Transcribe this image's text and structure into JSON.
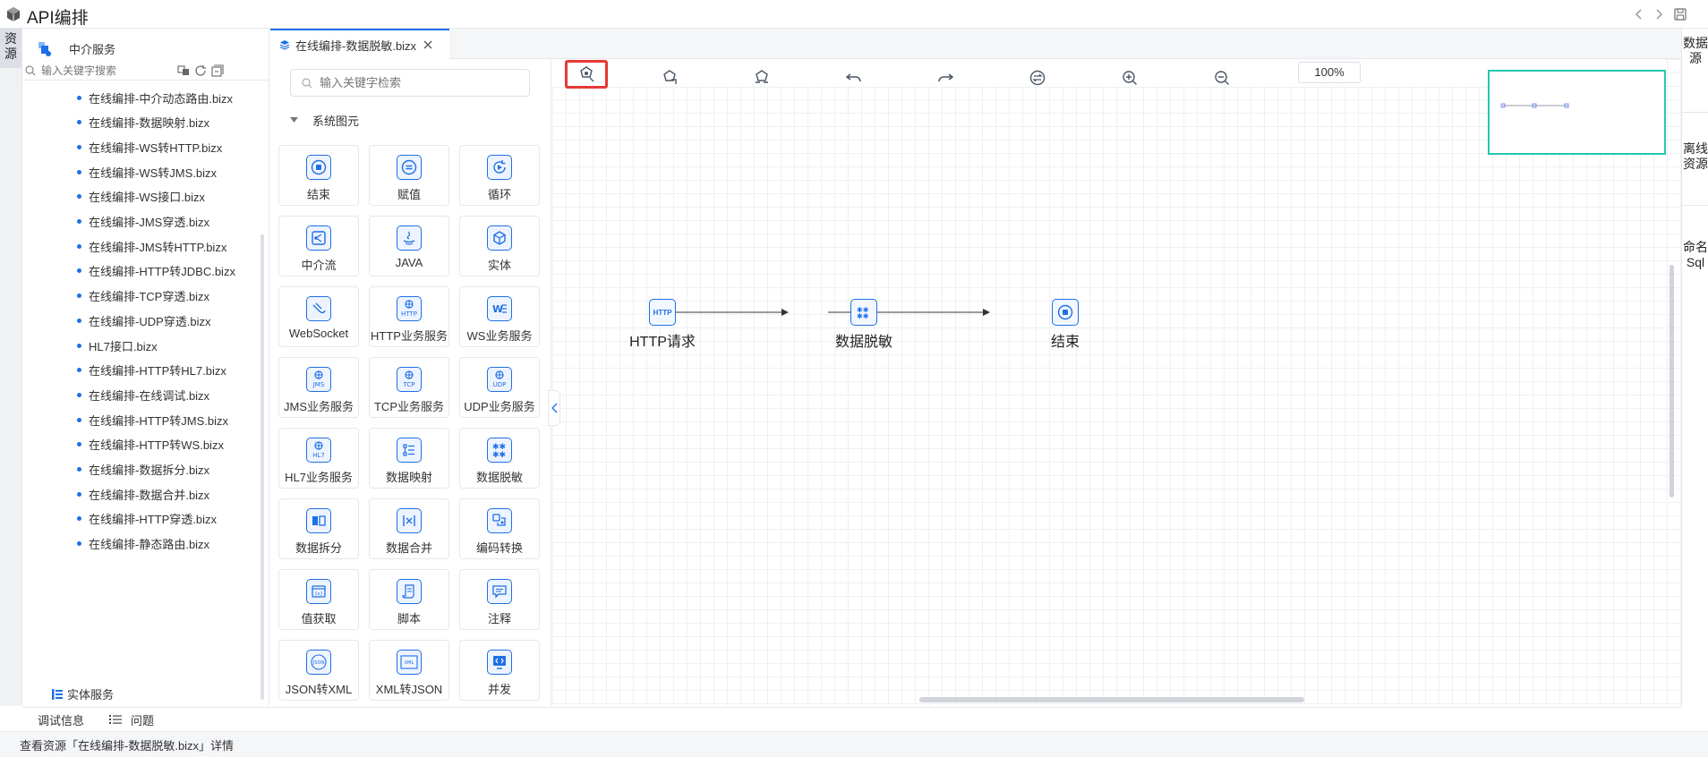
{
  "app": {
    "title": "API编排"
  },
  "left_rail": {
    "tab_label": "资源"
  },
  "resource_panel": {
    "service_title": "中介服务",
    "search_placeholder": "输入关键字搜索",
    "files": [
      "在线编排-中介动态路由.bizx",
      "在线编排-数据映射.bizx",
      "在线编排-WS转HTTP.bizx",
      "在线编排-WS转JMS.bizx",
      "在线编排-WS接口.bizx",
      "在线编排-JMS穿透.bizx",
      "在线编排-JMS转HTTP.bizx",
      "在线编排-HTTP转JDBC.bizx",
      "在线编排-TCP穿透.bizx",
      "在线编排-UDP穿透.bizx",
      "HL7接口.bizx",
      "在线编排-HTTP转HL7.bizx",
      "在线编排-在线调试.bizx",
      "在线编排-HTTP转JMS.bizx",
      "在线编排-HTTP转WS.bizx",
      "在线编排-数据拆分.bizx",
      "在线编排-数据合并.bizx",
      "在线编排-HTTP穿透.bizx",
      "在线编排-静态路由.bizx"
    ],
    "entity_service_label": "实体服务"
  },
  "editor_tab": {
    "label": "在线编排-数据脱敏.bizx"
  },
  "palette": {
    "search_placeholder": "输入关键字检索",
    "section_title": "系统图元",
    "items": [
      {
        "label": "结束",
        "icon": "stop-icon"
      },
      {
        "label": "赋值",
        "icon": "assign-icon"
      },
      {
        "label": "循环",
        "icon": "loop-icon"
      },
      {
        "label": "中介流",
        "icon": "flow-icon"
      },
      {
        "label": "JAVA",
        "icon": "java-icon"
      },
      {
        "label": "实体",
        "icon": "cube-icon"
      },
      {
        "label": "WebSocket",
        "icon": "websocket-icon"
      },
      {
        "label": "HTTP业务服务",
        "icon": "http-service-icon"
      },
      {
        "label": "WS业务服务",
        "icon": "ws-service-icon"
      },
      {
        "label": "JMS业务服务",
        "icon": "jms-service-icon"
      },
      {
        "label": "TCP业务服务",
        "icon": "tcp-service-icon"
      },
      {
        "label": "UDP业务服务",
        "icon": "udp-service-icon"
      },
      {
        "label": "HL7业务服务",
        "icon": "hl7-service-icon"
      },
      {
        "label": "数据映射",
        "icon": "data-mapping-icon"
      },
      {
        "label": "数据脱敏",
        "icon": "data-masking-icon"
      },
      {
        "label": "数据拆分",
        "icon": "data-split-icon"
      },
      {
        "label": "数据合并",
        "icon": "data-merge-icon"
      },
      {
        "label": "编码转换",
        "icon": "encoding-convert-icon"
      },
      {
        "label": "值获取",
        "icon": "value-get-icon"
      },
      {
        "label": "脚本",
        "icon": "script-icon"
      },
      {
        "label": "注释",
        "icon": "comment-icon"
      },
      {
        "label": "JSON转XML",
        "icon": "json-to-xml-icon"
      },
      {
        "label": "XML转JSON",
        "icon": "xml-to-json-icon"
      },
      {
        "label": "并发",
        "icon": "concurrent-icon"
      }
    ]
  },
  "toolbar": {
    "zoom_value": "100%"
  },
  "flow": {
    "nodes": [
      {
        "label": "HTTP请求",
        "icon_text": "HTTP"
      },
      {
        "label": "数据脱敏"
      },
      {
        "label": "结束"
      }
    ]
  },
  "right_rail": {
    "tabs": [
      "数据源",
      "离线资源",
      "命名Sql"
    ]
  },
  "bottom_tabs": {
    "debug": "调试信息",
    "problems": "问题"
  },
  "status": {
    "text": "查看资源「在线编排-数据脱敏.bizx」详情"
  },
  "colors": {
    "accent": "#1e6fe6",
    "highlight": "#e53935",
    "minimap_border": "#26c6b3"
  }
}
